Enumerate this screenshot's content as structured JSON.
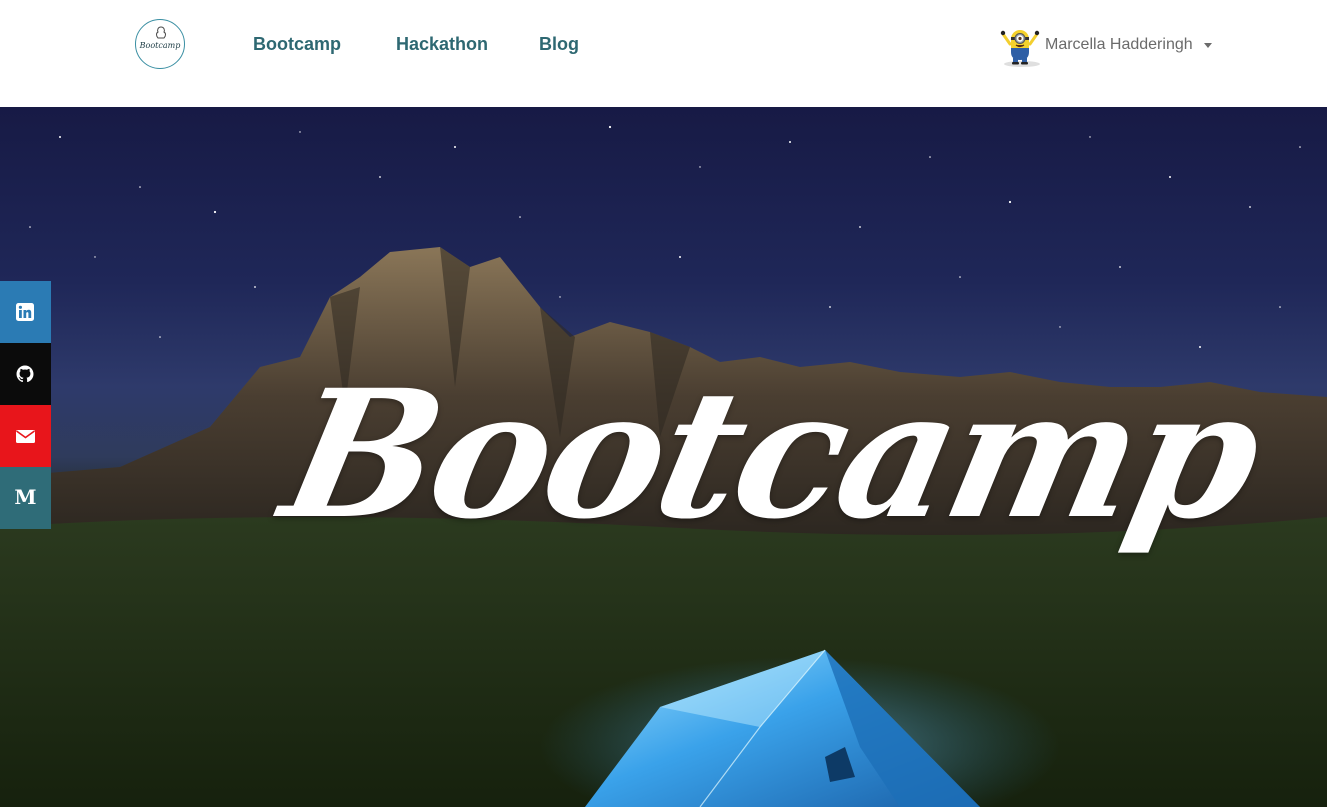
{
  "navbar": {
    "logo": {
      "text": "Bootcamp",
      "icon": "bootcamp-logo"
    },
    "links": [
      {
        "label": "Bootcamp"
      },
      {
        "label": "Hackathon"
      },
      {
        "label": "Blog"
      }
    ],
    "user": {
      "name": "Marcella Hadderingh",
      "avatar_icon": "minion-avatar"
    }
  },
  "hero": {
    "title": "Bootcamp",
    "background": "night sky over mountains with a glowing blue tent"
  },
  "social": {
    "items": [
      {
        "name": "linkedin",
        "icon": "linkedin-icon",
        "color": "#2b7bb4"
      },
      {
        "name": "github",
        "icon": "github-icon",
        "color": "#0b0b0b"
      },
      {
        "name": "email",
        "icon": "envelope-icon",
        "color": "#e8151b"
      },
      {
        "name": "medium",
        "icon": "medium-icon",
        "label": "M",
        "color": "#2f6c78"
      }
    ]
  },
  "colors": {
    "nav_link": "#2e6872",
    "user_name": "#6b6b6b",
    "tent": "#2f8fd8"
  }
}
